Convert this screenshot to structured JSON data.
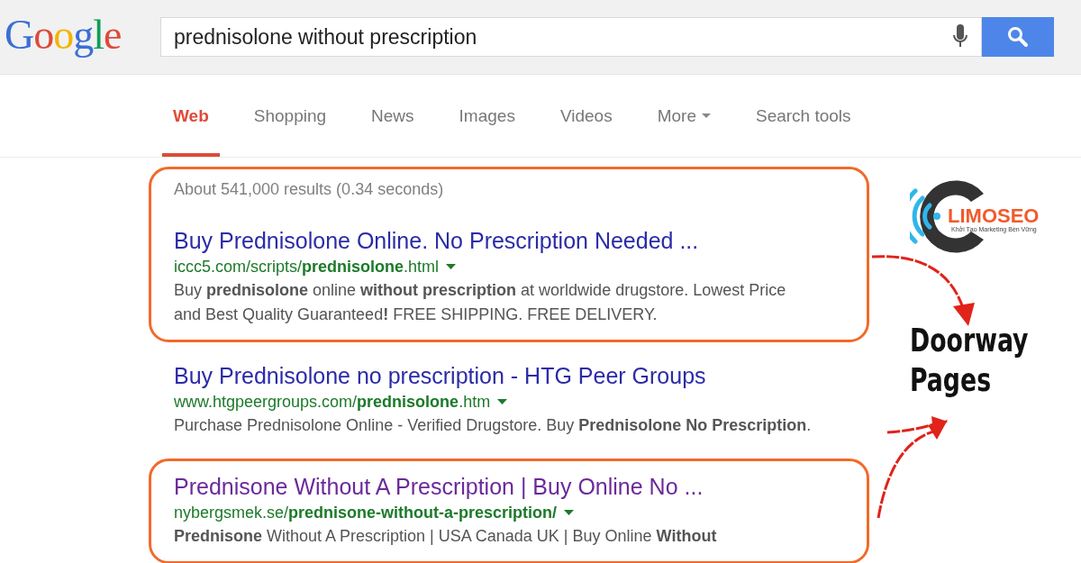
{
  "header": {
    "logo": "Google",
    "query": "prednisolone without prescription"
  },
  "tabs": [
    {
      "label": "Web",
      "selected": true,
      "kind": "tab"
    },
    {
      "label": "Shopping",
      "selected": false,
      "kind": "tab"
    },
    {
      "label": "News",
      "selected": false,
      "kind": "tab"
    },
    {
      "label": "Images",
      "selected": false,
      "kind": "tab"
    },
    {
      "label": "Videos",
      "selected": false,
      "kind": "tab"
    },
    {
      "label": "More",
      "selected": false,
      "kind": "dropdown"
    },
    {
      "label": "Search tools",
      "selected": false,
      "kind": "tab"
    }
  ],
  "stats": "About 541,000 results (0.34 seconds)",
  "results": [
    {
      "title": "Buy Prednisolone Online. No Prescription Needed ...",
      "visited": false,
      "highlighted": true,
      "url": "iccc5.com/scripts/**prednisolone**.html",
      "snippet_lines": [
        "Buy **prednisolone** online **without prescription** at worldwide drugstore. Lowest Price",
        "and Best Quality Guaranteed**!** FREE SHIPPING. FREE DELIVERY."
      ]
    },
    {
      "title": "Buy Prednisolone no prescription - HTG Peer Groups",
      "visited": false,
      "highlighted": false,
      "url": "www.htgpeergroups.com/**prednisolone**.htm",
      "snippet_lines": [
        "Purchase Prednisolone Online - Verified Drugstore. Buy **Prednisolone No Prescription**."
      ]
    },
    {
      "title": "Prednisone Without A Prescription | Buy Online No ...",
      "visited": true,
      "highlighted": true,
      "url": "nybergsmek.se/**prednisone-without-a-prescription/**",
      "snippet_lines": [
        "**Prednisone** Without A Prescription | USA Canada UK | Buy Online **Without**"
      ]
    }
  ],
  "brand": {
    "name": "LIMOSEO",
    "tagline": "Khởi Tạo Marketing Bền Vững"
  },
  "annotation": {
    "label_lines": [
      "Doorway",
      "Pages"
    ]
  }
}
